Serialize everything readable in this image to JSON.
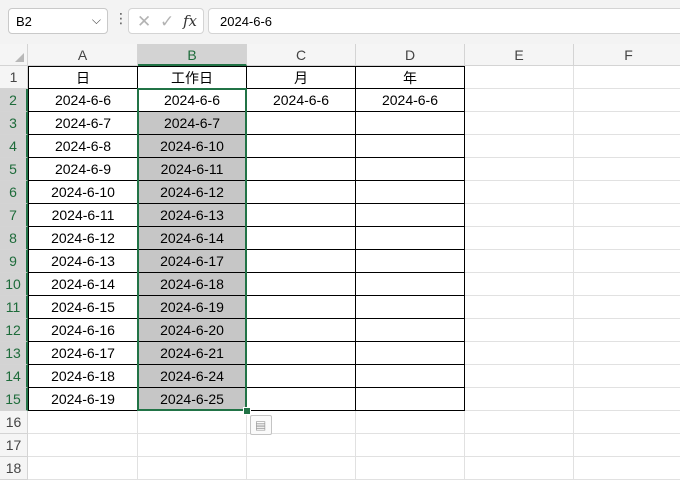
{
  "formula_bar": {
    "name_box": "B2",
    "name_box_chevron": "⌵",
    "more_dots": "⋮",
    "cancel_glyph": "✕",
    "enter_glyph": "✓",
    "fx_label": "fx",
    "formula_value": "2024-6-6"
  },
  "icons": {
    "name-box-dropdown": "chevron-down-icon",
    "cancel": "x-icon",
    "enter": "checkmark-icon",
    "insert-function": "fx-icon",
    "paste-options": "clipboard-icon"
  },
  "colors": {
    "selection": "#217346",
    "highlight_fill": "#c6c6c6",
    "header_bg": "#f5f5f5"
  },
  "sheet": {
    "columns": [
      "A",
      "B",
      "C",
      "D",
      "E",
      "F"
    ],
    "rows": [
      "1",
      "2",
      "3",
      "4",
      "5",
      "6",
      "7",
      "8",
      "9",
      "10",
      "11",
      "12",
      "13",
      "14",
      "15",
      "16",
      "17",
      "18"
    ],
    "selected_column": "B",
    "active_cell": "B2",
    "selected_range": "B2:B15",
    "headers": [
      "日",
      "工作日",
      "月",
      "年"
    ],
    "data": [
      [
        "2024-6-6",
        "2024-6-6",
        "2024-6-6",
        "2024-6-6"
      ],
      [
        "2024-6-7",
        "2024-6-7",
        "",
        ""
      ],
      [
        "2024-6-8",
        "2024-6-10",
        "",
        ""
      ],
      [
        "2024-6-9",
        "2024-6-11",
        "",
        ""
      ],
      [
        "2024-6-10",
        "2024-6-12",
        "",
        ""
      ],
      [
        "2024-6-11",
        "2024-6-13",
        "",
        ""
      ],
      [
        "2024-6-12",
        "2024-6-14",
        "",
        ""
      ],
      [
        "2024-6-13",
        "2024-6-17",
        "",
        ""
      ],
      [
        "2024-6-14",
        "2024-6-18",
        "",
        ""
      ],
      [
        "2024-6-15",
        "2024-6-19",
        "",
        ""
      ],
      [
        "2024-6-16",
        "2024-6-20",
        "",
        ""
      ],
      [
        "2024-6-17",
        "2024-6-21",
        "",
        ""
      ],
      [
        "2024-6-18",
        "2024-6-24",
        "",
        ""
      ],
      [
        "2024-6-19",
        "2024-6-25",
        "",
        ""
      ]
    ]
  }
}
